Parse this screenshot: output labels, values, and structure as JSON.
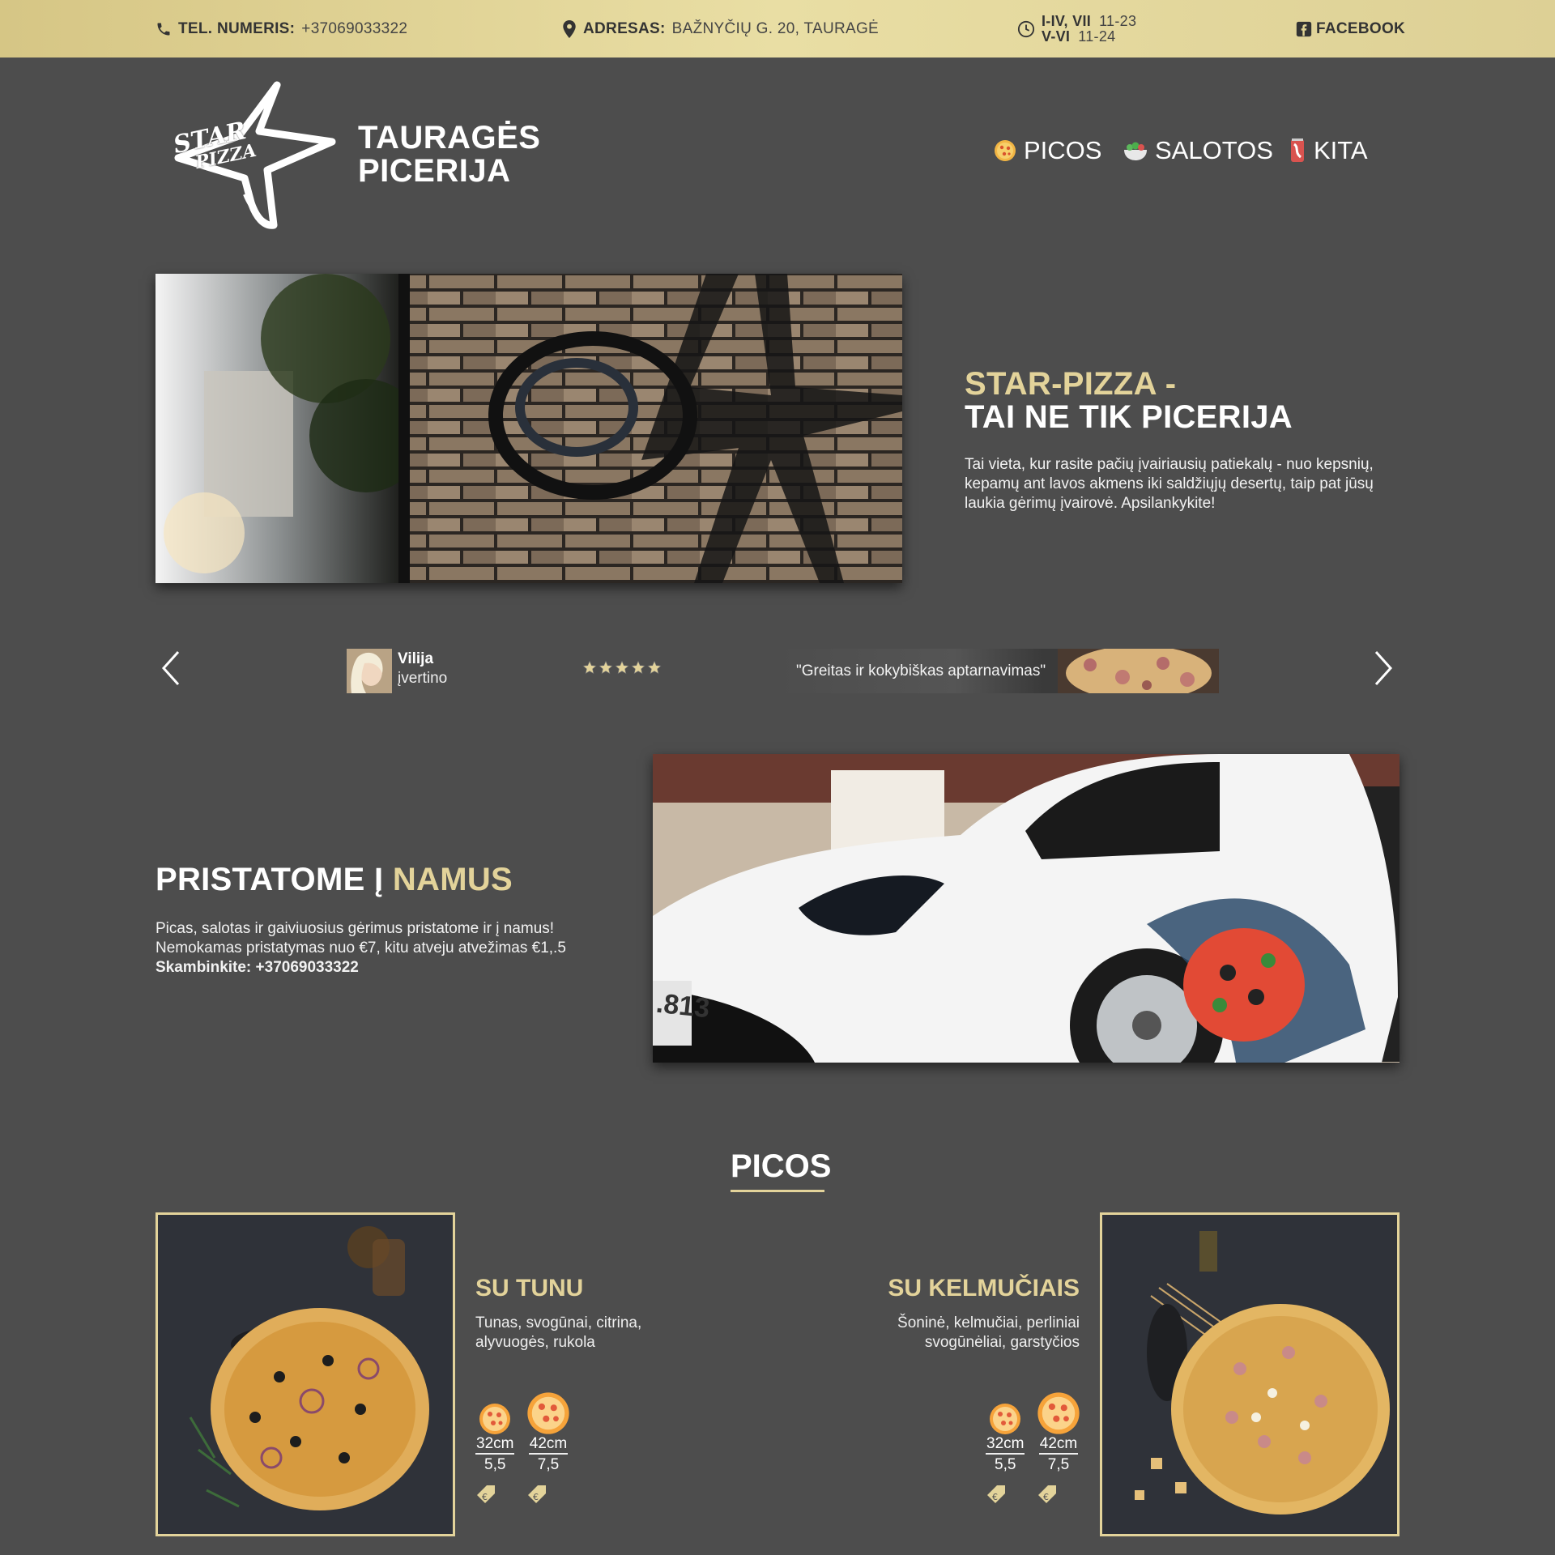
{
  "topbar": {
    "phone_label": "TEL. NUMERIS:",
    "phone_value": "+37069033322",
    "address_label": "ADRESAS:",
    "address_value": "BAŽNYČIŲ G. 20, TAURAGĖ",
    "hours": [
      {
        "days": "I-IV, VII",
        "time": "11-23"
      },
      {
        "days": "V-VI",
        "time": "11-24"
      }
    ],
    "facebook_label": "FACEBOOK"
  },
  "header": {
    "logo_text_1": "STAR",
    "logo_text_2": "PIZZA",
    "title_line1": "TAURAGĖS",
    "title_line2": "PICERIJA",
    "nav": [
      {
        "label": "PICOS",
        "icon": "pizza-icon"
      },
      {
        "label": "SALOTOS",
        "icon": "salad-icon"
      },
      {
        "label": "KITA",
        "icon": "drink-can-icon"
      }
    ]
  },
  "intro": {
    "heading_line1": "STAR-PIZZA -",
    "heading_line2": "TAI NE TIK PICERIJA",
    "text": "Tai vieta, kur rasite pačių įvairiausių patiekalų - nuo kepsnių, kepamų ant lavos akmens iki saldžiųjų desertų, taip pat jūsų laukia gėrimų įvairovė. Apsilankykite!"
  },
  "review": {
    "name": "Vilija",
    "action": "įvertino",
    "rating": 5,
    "quote": "\"Greitas ir kokybiškas aptarnavimas\""
  },
  "delivery": {
    "heading_white": "PRISTATOME Į",
    "heading_gold": "NAMUS",
    "line1": "Picas, salotas ir gaiviuosius gėrimus pristatome ir į namus!",
    "line2": "Nemokamas pristatymas nuo €7, kitu atveju atvežimas €1,.5",
    "line3": "Skambinkite: +37069033322",
    "car_plate": ".813"
  },
  "pizzas_section": {
    "title": "PICOS",
    "items": [
      {
        "name": "SU TUNU",
        "desc_line1": "Tunas, svogūnai, citrina,",
        "desc_line2": "alyvuogės, rukola",
        "sizes": [
          {
            "size": "32cm",
            "price": "5,5"
          },
          {
            "size": "42cm",
            "price": "7,5"
          }
        ]
      },
      {
        "name": "SU KELMUČIAIS",
        "desc_line1": "Šoninė, kelmučiai, perliniai",
        "desc_line2": "svogūnėliai, garstyčios",
        "sizes": [
          {
            "size": "32cm",
            "price": "5,5"
          },
          {
            "size": "42cm",
            "price": "7,5"
          }
        ]
      }
    ]
  },
  "colors": {
    "accent_gold": "#e3d39a",
    "background": "#4d4d4d",
    "topbar": "#e0d394"
  }
}
